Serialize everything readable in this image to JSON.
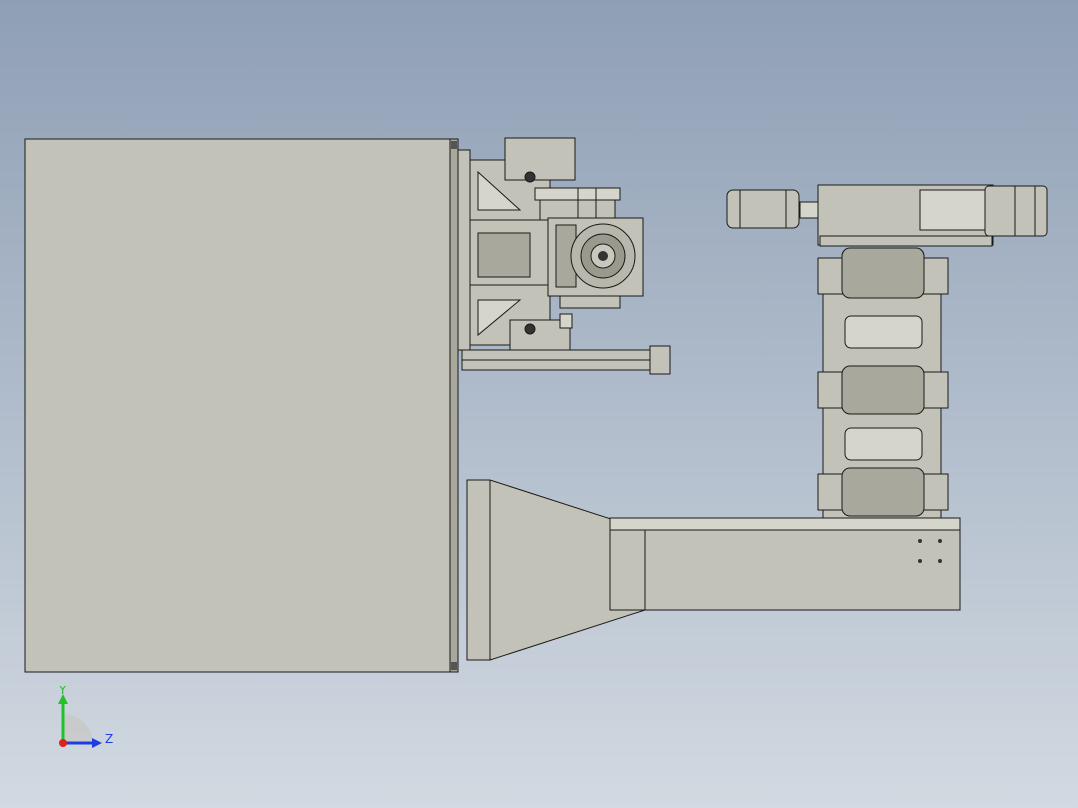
{
  "view": {
    "background_top": "#8f9fb5",
    "background_bottom": "#d2d9e1",
    "part_fill": "#c3c2b8",
    "edge_color": "#1a1a1a"
  },
  "triad": {
    "y_label": "Y",
    "z_label": "Z",
    "y_color": "#22c02a",
    "z_color": "#1e3fe0",
    "x_color": "#e02020"
  }
}
